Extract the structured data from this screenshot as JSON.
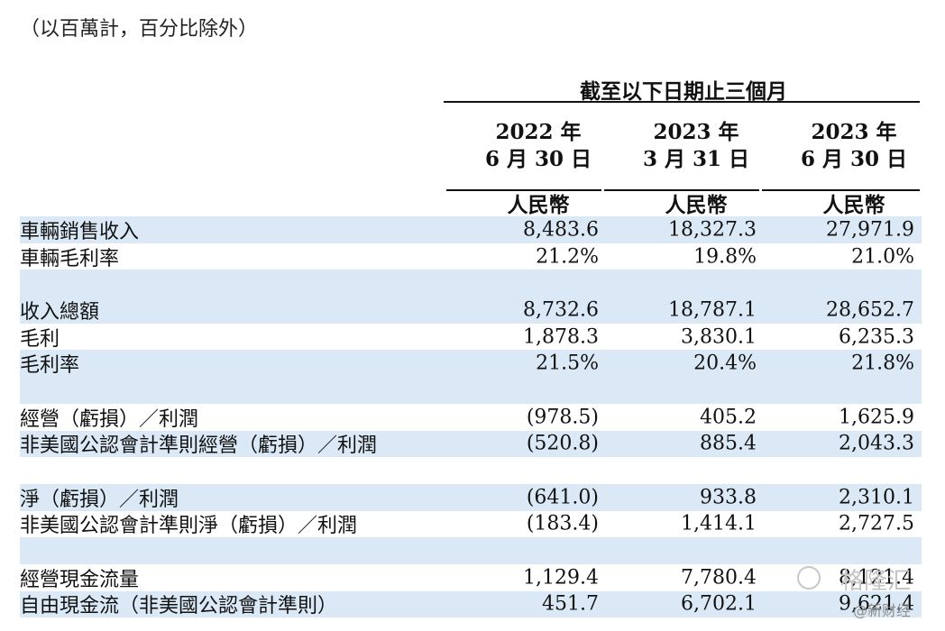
{
  "note": "（以百萬計，百分比除外）",
  "period_header": "截至以下日期止三個月",
  "columns": [
    {
      "line1": "2022 年",
      "line2": "6 月 30 日",
      "currency": "人民幣"
    },
    {
      "line1": "2023 年",
      "line2": "3 月 31 日",
      "currency": "人民幣"
    },
    {
      "line1": "2023 年",
      "line2": "6 月 30 日",
      "currency": "人民幣"
    }
  ],
  "rows": [
    {
      "label": "車輛銷售收入",
      "v1": "8,483.6",
      "v2": "18,327.3",
      "v3": "27,971.9"
    },
    {
      "label": "車輛毛利率",
      "v1": "21.2%",
      "v2": "19.8%",
      "v3": "21.0%"
    },
    {
      "label": "",
      "v1": "",
      "v2": "",
      "v3": ""
    },
    {
      "label": "收入總額",
      "v1": "8,732.6",
      "v2": "18,787.1",
      "v3": "28,652.7"
    },
    {
      "label": "毛利",
      "v1": "1,878.3",
      "v2": "3,830.1",
      "v3": "6,235.3"
    },
    {
      "label": "毛利率",
      "v1": "21.5%",
      "v2": "20.4%",
      "v3": "21.8%"
    },
    {
      "label": "",
      "v1": "",
      "v2": "",
      "v3": ""
    },
    {
      "label": "經營（虧損）／利潤",
      "v1": "(978.5)",
      "v2": "405.2",
      "v3": "1,625.9"
    },
    {
      "label": "非美國公認會計準則經營（虧損）／利潤",
      "v1": "(520.8)",
      "v2": "885.4",
      "v3": "2,043.3"
    },
    {
      "label": "",
      "v1": "",
      "v2": "",
      "v3": ""
    },
    {
      "label": "淨（虧損）／利潤",
      "v1": "(641.0)",
      "v2": "933.8",
      "v3": "2,310.1"
    },
    {
      "label": "非美國公認會計準則淨（虧損）／利潤",
      "v1": "(183.4)",
      "v2": "1,414.1",
      "v3": "2,727.5"
    },
    {
      "label": "",
      "v1": "",
      "v2": "",
      "v3": ""
    },
    {
      "label": "經營現金流量",
      "v1": "1,129.4",
      "v2": "7,780.4",
      "v3": "8,121.4"
    },
    {
      "label": "自由現金流（非美國公認會計準則）",
      "v1": "451.7",
      "v2": "6,702.1",
      "v3": "9,621.4"
    }
  ],
  "watermark": {
    "main": "格隆汇",
    "sub": "@新财经"
  }
}
